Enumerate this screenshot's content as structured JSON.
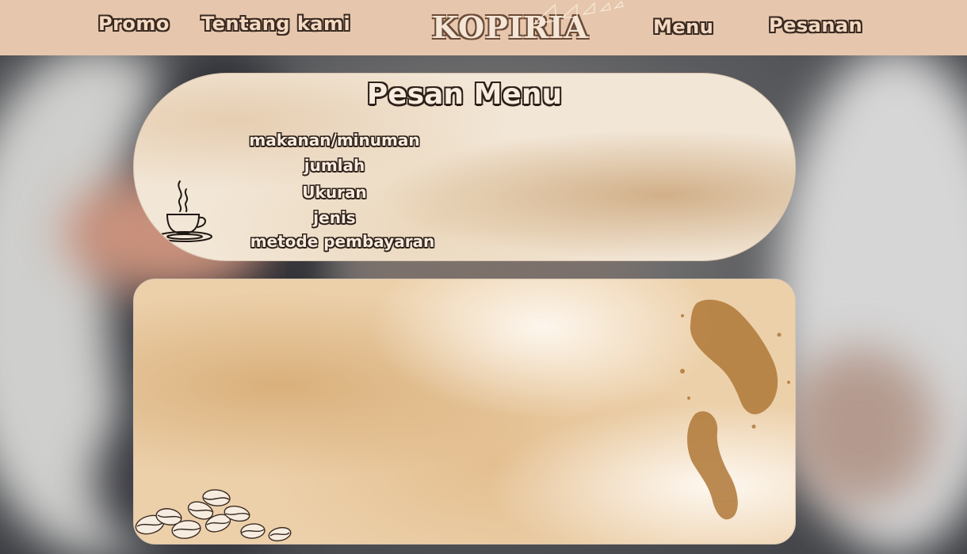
{
  "colors": {
    "navbar_bg": "#e6c7ad",
    "nav_text": "#f4d9c2",
    "outline": "#3a2a21",
    "panel_bg": "#f2e6d6"
  },
  "nav": {
    "promo": "Promo",
    "about": "Tentang kami",
    "logo": "KOPIRIA",
    "menu": "Menu",
    "orders": "Pesanan"
  },
  "order_form": {
    "title": "Pesan Menu",
    "fields": [
      {
        "label": "makanan/minuman"
      },
      {
        "label": "jumlah"
      },
      {
        "label": "Ukuran"
      },
      {
        "label": "jenis"
      },
      {
        "label": "metode pembayaran"
      }
    ]
  },
  "icons": {
    "cup": "coffee-cup-icon",
    "beans": "coffee-beans-icon",
    "splash": "coffee-splash-icon"
  }
}
